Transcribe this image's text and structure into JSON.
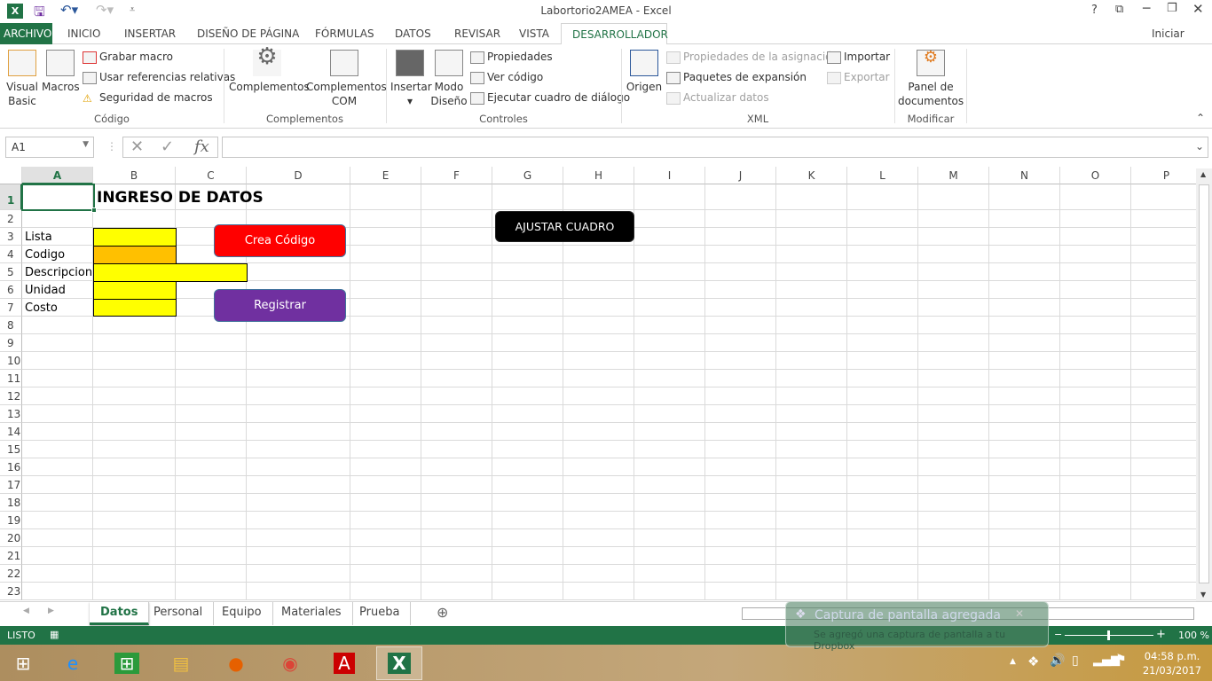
{
  "window": {
    "title": "Labortorio2AMEA - Excel",
    "help": "?",
    "signin": "Iniciar sesión"
  },
  "ribbon_tabs": [
    "ARCHIVO",
    "INICIO",
    "INSERTAR",
    "DISEÑO DE PÁGINA",
    "FÓRMULAS",
    "DATOS",
    "REVISAR",
    "VISTA",
    "DESARROLLADOR"
  ],
  "ribbon": {
    "codigo": {
      "visual_basic": "Visual Basic",
      "macros": "Macros",
      "grabar": "Grabar macro",
      "usar_ref": "Usar referencias relativas",
      "seguridad": "Seguridad de macros",
      "group": "Código"
    },
    "complementos": {
      "comp": "Complementos",
      "com_line1": "Complementos",
      "com_line2": "COM",
      "group": "Complementos"
    },
    "controles": {
      "insertar": "Insertar",
      "modo1": "Modo",
      "modo2": "Diseño",
      "propiedades": "Propiedades",
      "ver_codigo": "Ver código",
      "ejecutar": "Ejecutar cuadro de diálogo",
      "group": "Controles"
    },
    "xml": {
      "origen": "Origen",
      "prop_asig": "Propiedades de la asignación",
      "paquetes": "Paquetes de expansión",
      "actualizar": "Actualizar datos",
      "importar": "Importar",
      "exportar": "Exportar",
      "group": "XML"
    },
    "modificar": {
      "panel1": "Panel de",
      "panel2": "documentos",
      "group": "Modificar"
    }
  },
  "formula_bar": {
    "name_box": "A1",
    "fx": "fx",
    "value": ""
  },
  "columns": [
    "A",
    "B",
    "C",
    "D",
    "E",
    "F",
    "G",
    "H",
    "I",
    "J",
    "K",
    "L",
    "M",
    "N",
    "O",
    "P"
  ],
  "rows": [
    "1",
    "2",
    "3",
    "4",
    "5",
    "6",
    "7",
    "8",
    "9",
    "10",
    "11",
    "12",
    "13",
    "14",
    "15",
    "16",
    "17",
    "18",
    "19",
    "20",
    "21",
    "22",
    "23"
  ],
  "cells": {
    "title": "INGRESO DE DATOS",
    "labels": [
      "Lista",
      "Codigo",
      "Descripcion",
      "Unidad",
      "Costo"
    ]
  },
  "buttons": {
    "crea": "Crea Código",
    "registrar": "Registrar",
    "ajustar": "AJUSTAR CUADRO"
  },
  "colors": {
    "excel_green": "#217346",
    "yellow": "#ffff00",
    "orange": "#ffc000",
    "crea": "#ff0000",
    "registrar": "#7030a0",
    "ajustar": "#000000"
  },
  "sheets": [
    "Datos",
    "Personal",
    "Equipo",
    "Materiales",
    "Prueba"
  ],
  "status": {
    "ready": "LISTO",
    "zoom": "100 %"
  },
  "toast": {
    "title": "Captura de pantalla agregada",
    "body": "Se agregó una captura de pantalla a tu Dropbox"
  },
  "clock": {
    "time": "04:58 p.m.",
    "date": "21/03/2017"
  }
}
